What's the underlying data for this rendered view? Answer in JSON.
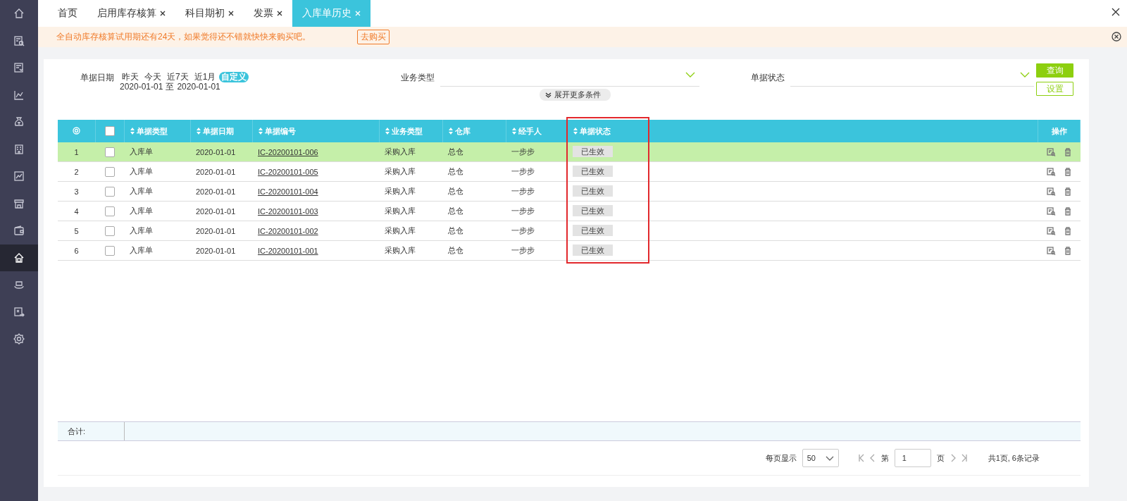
{
  "sidebar": {
    "items": [
      {
        "selected": false
      },
      {
        "selected": false
      },
      {
        "selected": false
      },
      {
        "selected": false
      },
      {
        "selected": false
      },
      {
        "selected": false
      },
      {
        "selected": false
      },
      {
        "selected": false
      },
      {
        "selected": false
      },
      {
        "selected": true
      },
      {
        "selected": false
      },
      {
        "selected": false
      },
      {
        "selected": false
      }
    ]
  },
  "tabs": [
    {
      "label": "首页",
      "closable": false,
      "selected": false
    },
    {
      "label": "启用库存核算",
      "closable": true,
      "selected": false
    },
    {
      "label": "科目期初",
      "closable": true,
      "selected": false
    },
    {
      "label": "发票",
      "closable": true,
      "selected": false
    },
    {
      "label": "入库单历史",
      "closable": true,
      "selected": true
    }
  ],
  "banner": {
    "message": "全自动库存核算试用期还有24天，如果觉得还不错就快快来购买吧。",
    "button": "去购买"
  },
  "filters": {
    "date": {
      "label": "单据日期",
      "quick": [
        {
          "label": "昨天",
          "selected": false
        },
        {
          "label": "今天",
          "selected": false
        },
        {
          "label": "近7天",
          "selected": false
        },
        {
          "label": "近1月",
          "selected": false
        },
        {
          "label": "自定义",
          "selected": true
        }
      ],
      "range_start": "2020-01-01",
      "range_separator": "至",
      "range_end": "2020-01-01"
    },
    "business_type": {
      "label": "业务类型"
    },
    "status": {
      "label": "单据状态"
    },
    "expand": "展开更多条件",
    "query_button": "查询",
    "settings_button": "设置"
  },
  "table": {
    "select_all_checked": false,
    "columns": [
      {
        "label": "单据类型",
        "sortable": true,
        "highlighted": false
      },
      {
        "label": "单据日期",
        "sortable": true,
        "highlighted": false
      },
      {
        "label": "单据编号",
        "sortable": true,
        "highlighted": false
      },
      {
        "label": "业务类型",
        "sortable": true,
        "highlighted": false
      },
      {
        "label": "仓库",
        "sortable": true,
        "highlighted": false
      },
      {
        "label": "经手人",
        "sortable": true,
        "highlighted": false
      },
      {
        "label": "单据状态",
        "sortable": true,
        "highlighted": true
      }
    ],
    "actions_column": "操作",
    "rows": [
      {
        "index": "1",
        "checked": false,
        "selected": true,
        "type": "入库单",
        "date": "2020-01-01",
        "number": "IC-20200101-006",
        "business": "采购入库",
        "warehouse": "总仓",
        "handler": "一步步",
        "status": "已生效"
      },
      {
        "index": "2",
        "checked": false,
        "selected": false,
        "type": "入库单",
        "date": "2020-01-01",
        "number": "IC-20200101-005",
        "business": "采购入库",
        "warehouse": "总仓",
        "handler": "一步步",
        "status": "已生效"
      },
      {
        "index": "3",
        "checked": false,
        "selected": false,
        "type": "入库单",
        "date": "2020-01-01",
        "number": "IC-20200101-004",
        "business": "采购入库",
        "warehouse": "总仓",
        "handler": "一步步",
        "status": "已生效"
      },
      {
        "index": "4",
        "checked": false,
        "selected": false,
        "type": "入库单",
        "date": "2020-01-01",
        "number": "IC-20200101-003",
        "business": "采购入库",
        "warehouse": "总仓",
        "handler": "一步步",
        "status": "已生效"
      },
      {
        "index": "5",
        "checked": false,
        "selected": false,
        "type": "入库单",
        "date": "2020-01-01",
        "number": "IC-20200101-002",
        "business": "采购入库",
        "warehouse": "总仓",
        "handler": "一步步",
        "status": "已生效"
      },
      {
        "index": "6",
        "checked": false,
        "selected": false,
        "type": "入库单",
        "date": "2020-01-01",
        "number": "IC-20200101-001",
        "business": "采购入库",
        "warehouse": "总仓",
        "handler": "一步步",
        "status": "已生效"
      }
    ],
    "summary_label": "合计:"
  },
  "pagination": {
    "per_page_label": "每页显示",
    "per_page": "50",
    "page_prefix": "第",
    "page": "1",
    "page_suffix": "页",
    "total": "共1页, 6条记录"
  }
}
